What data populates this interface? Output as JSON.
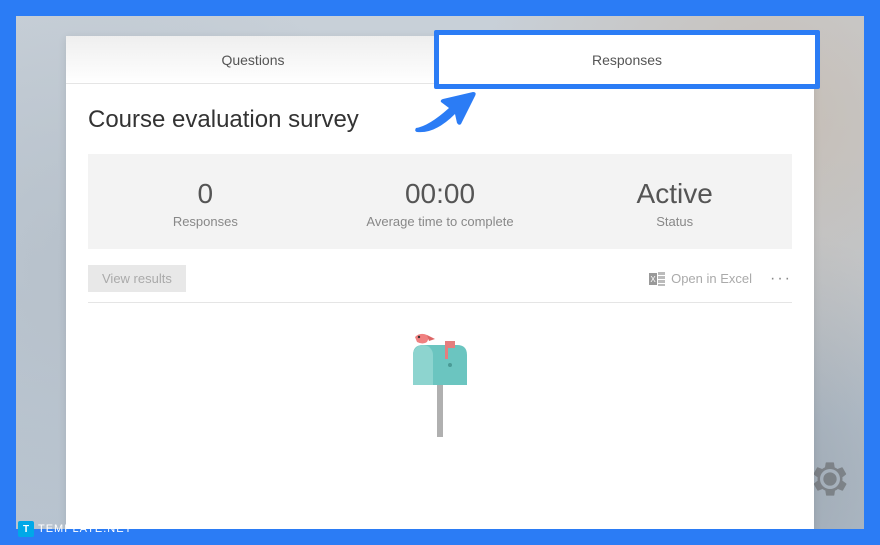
{
  "tabs": {
    "questions": "Questions",
    "responses": "Responses"
  },
  "survey": {
    "title": "Course evaluation survey"
  },
  "stats": {
    "responses_value": "0",
    "responses_label": "Responses",
    "avgtime_value": "00:00",
    "avgtime_label": "Average time to complete",
    "status_value": "Active",
    "status_label": "Status"
  },
  "actions": {
    "view_results": "View results",
    "open_excel": "Open in Excel",
    "more": "···"
  },
  "watermark": {
    "badge": "T",
    "text": "TEMPLATE.NET"
  }
}
